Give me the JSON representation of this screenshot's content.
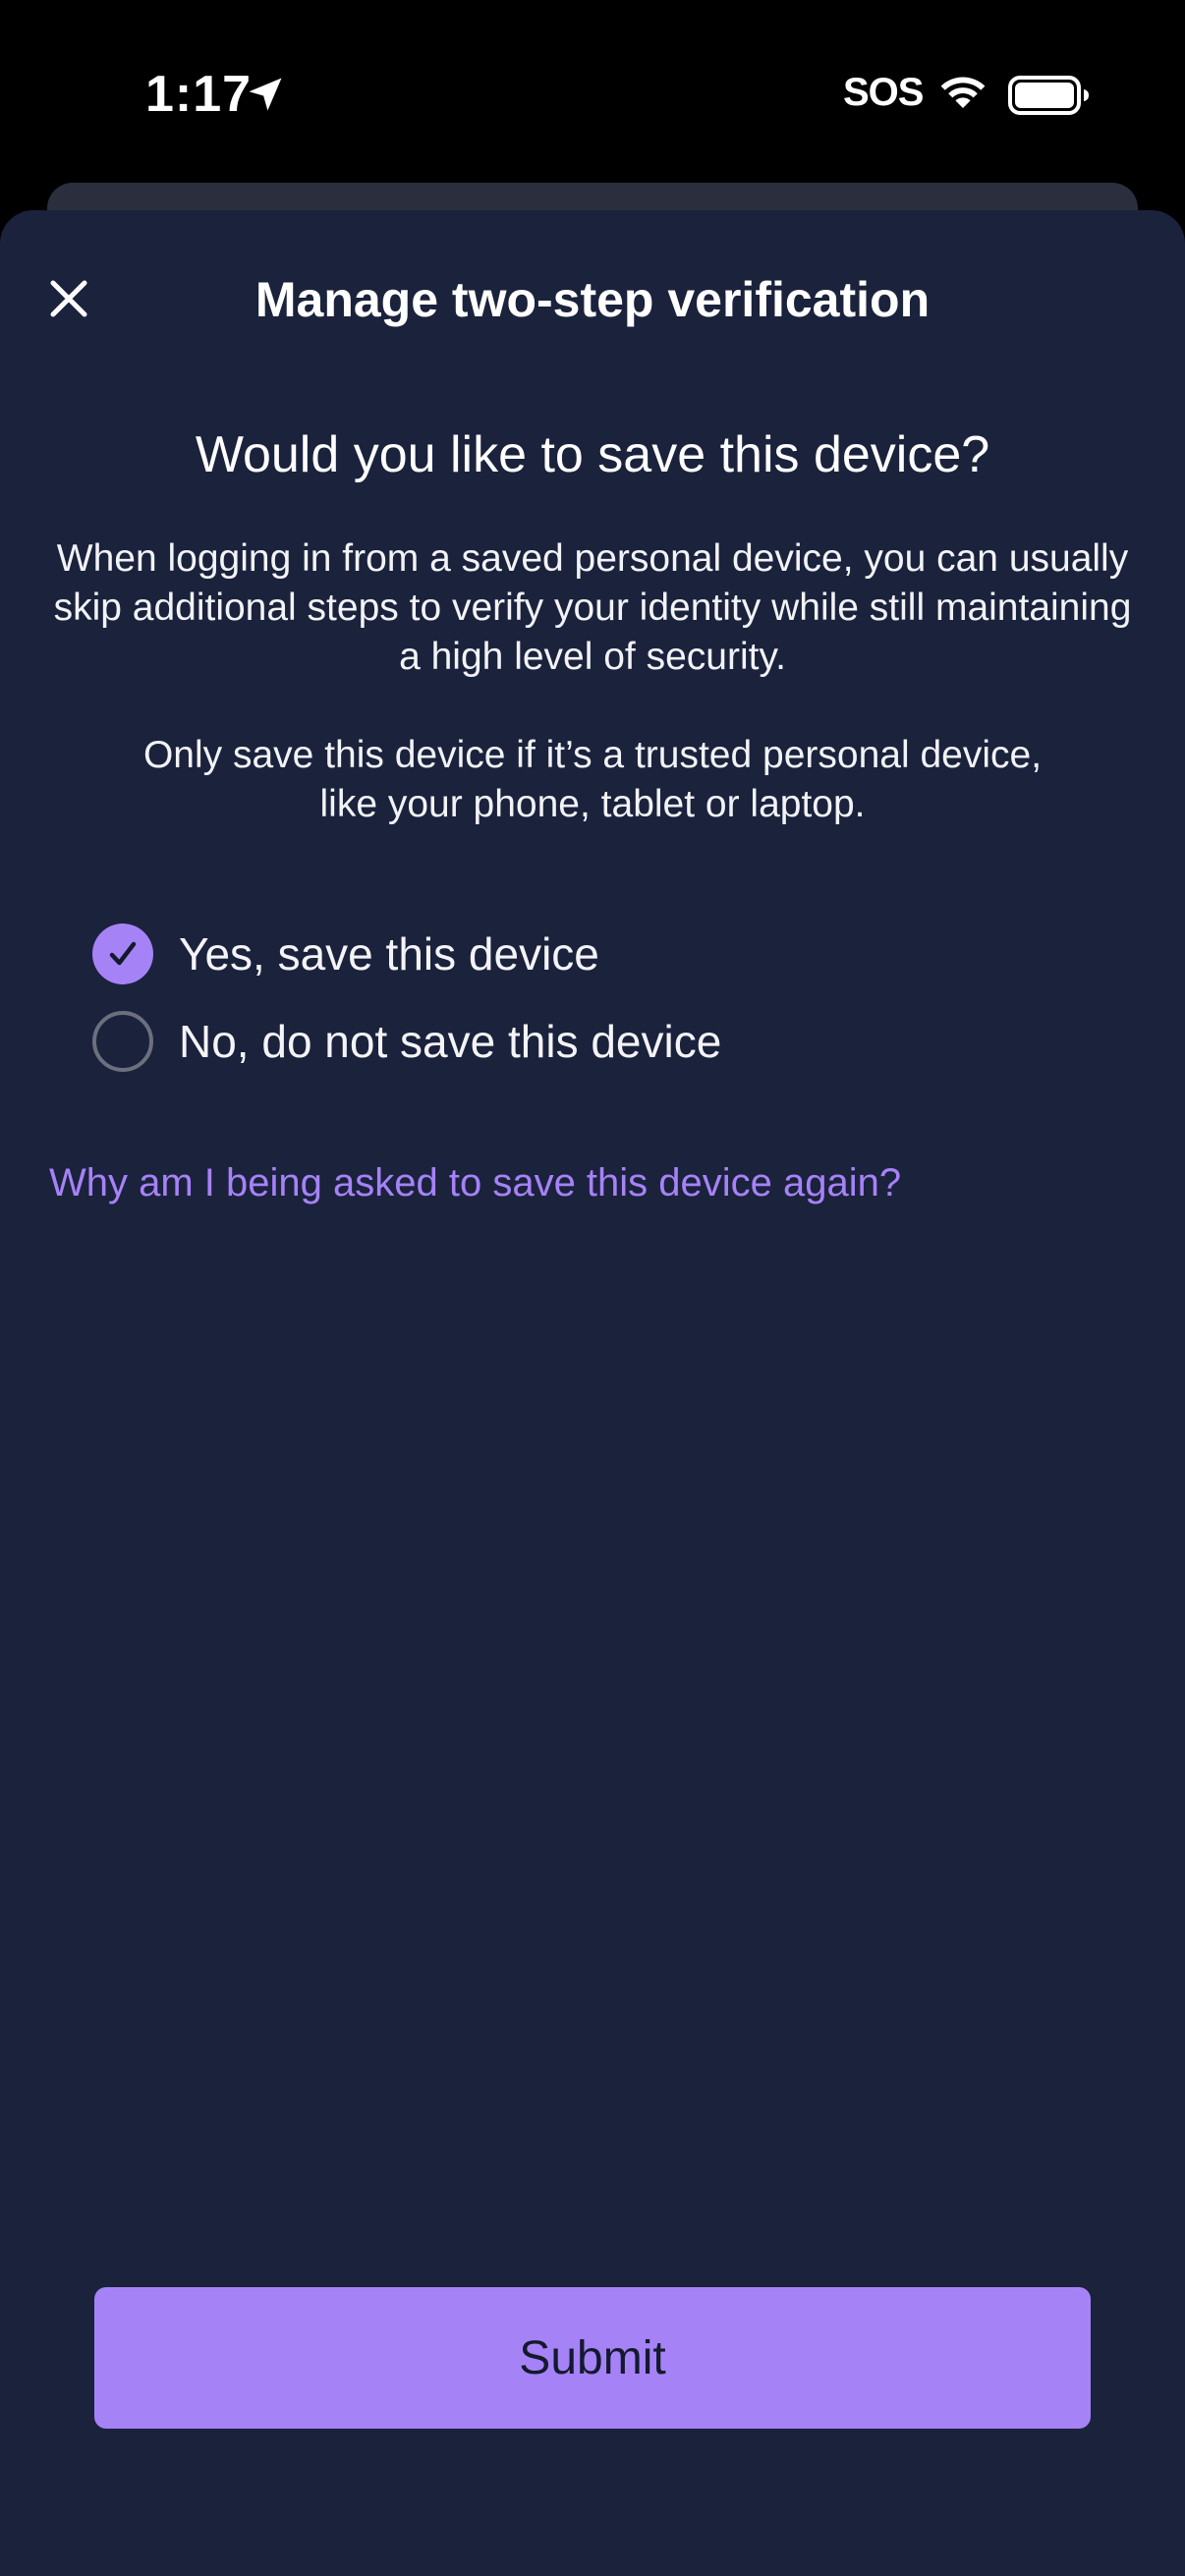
{
  "status_bar": {
    "time": "1:17",
    "sos": "SOS",
    "icons": [
      "location-arrow-icon",
      "wifi-icon",
      "battery-icon"
    ]
  },
  "header": {
    "title": "Manage two-step verification",
    "close_icon": "close-icon"
  },
  "main": {
    "question": "Would you like to save this device?",
    "paragraph1": "When logging in from a saved personal device, you can usually skip additional steps to verify your identity while still maintaining a high level of security.",
    "paragraph2": "Only save this device if it’s a trusted personal device, like your phone, tablet or laptop.",
    "options": [
      {
        "label": "Yes, save this device",
        "selected": true
      },
      {
        "label": "No, do not save this device",
        "selected": false
      }
    ],
    "help_link": "Why am I being asked to save this device again?"
  },
  "footer": {
    "submit_label": "Submit"
  },
  "colors": {
    "background": "#1b223c",
    "accent": "#a682f7",
    "submit_text": "#141a2e"
  }
}
